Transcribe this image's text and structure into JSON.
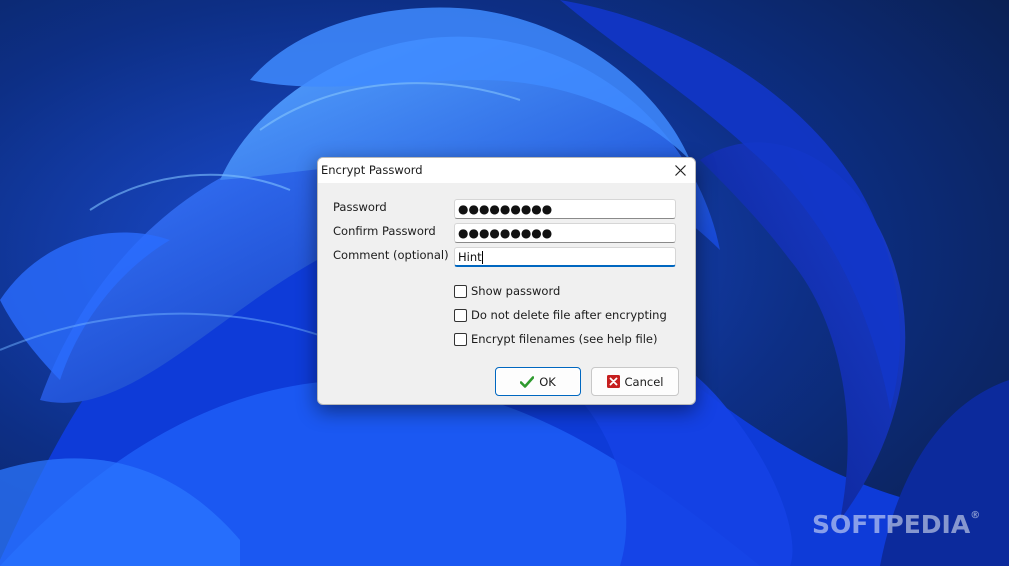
{
  "watermark": {
    "text": "SOFTPEDIA",
    "mark": "®"
  },
  "dialog": {
    "title": "Encrypt Password",
    "close_icon": "close-icon",
    "labels": {
      "password": "Password",
      "confirm_password": "Confirm Password",
      "comment": "Comment (optional)"
    },
    "fields": {
      "password_value": "●●●●●●●●●",
      "confirm_value": "●●●●●●●●●",
      "comment_value": "Hint"
    },
    "checkboxes": [
      {
        "label": "Show password",
        "checked": false
      },
      {
        "label": "Do not delete file after encrypting",
        "checked": false
      },
      {
        "label": "Encrypt filenames (see help file)",
        "checked": false
      }
    ],
    "buttons": {
      "ok_label": "OK",
      "ok_icon": "checkmark-icon",
      "cancel_label": "Cancel",
      "cancel_icon": "red-x-icon"
    },
    "colors": {
      "accent": "#0067c0",
      "ok_check": "#2e9a2e",
      "cancel_x": "#c61f1f"
    }
  }
}
